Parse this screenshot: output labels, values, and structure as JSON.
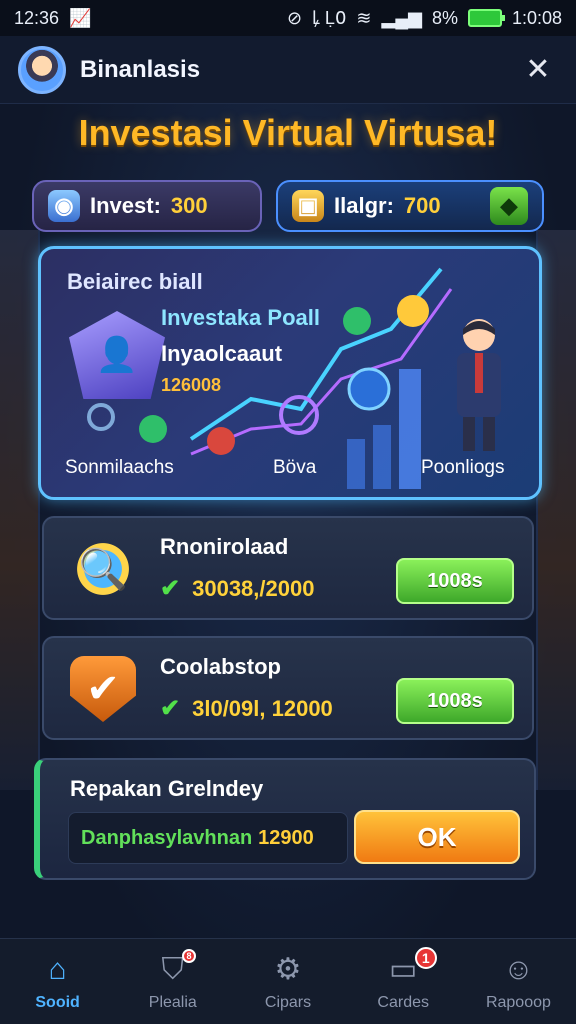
{
  "status_bar": {
    "time": "12:36",
    "carrier_info": "ꝲ Ḷ߀",
    "battery_percent": "8%",
    "clock_right": "1:0:08"
  },
  "header": {
    "title": "Binanlasis"
  },
  "page_title": "Investasi Virtual Virtusa!",
  "stats": {
    "invest_label": "Invest:",
    "invest_value": "300",
    "balance_label": "Ilalgr:",
    "balance_value": "700"
  },
  "hero": {
    "title": "Beiairec biall",
    "heading": "Investaka Poall",
    "subheading": "Inyaolcaaut",
    "number": "126008",
    "labels": [
      "Sonmilaachs",
      "Böva",
      "Poonliogs"
    ]
  },
  "tasks": [
    {
      "title": "Rnonirolaad",
      "progress": "30038,/2000",
      "button": "1008s"
    },
    {
      "title": "Coolabstop",
      "progress": "3l0/09l, 12000",
      "button": "1008s"
    }
  ],
  "reward": {
    "title": "Repakan Grelndey",
    "field_text": "Danphasylavhnan",
    "field_amount": "12900",
    "ok_button": "OK"
  },
  "bottom_nav": [
    {
      "label": "Sooid",
      "icon": "home-icon",
      "active": true,
      "badge": ""
    },
    {
      "label": "Plealia",
      "icon": "shield-check-icon",
      "active": false,
      "badge": "8"
    },
    {
      "label": "Cipars",
      "icon": "gear-icon",
      "active": false,
      "badge": ""
    },
    {
      "label": "Cardes",
      "icon": "cards-icon",
      "active": false,
      "badge": "1"
    },
    {
      "label": "Rapooop",
      "icon": "profile-icon",
      "active": false,
      "badge": ""
    }
  ],
  "colors": {
    "accent_gold": "#ffb826",
    "accent_blue": "#4fb3ff",
    "button_green": "#3ea82a",
    "button_orange": "#f07a12"
  }
}
